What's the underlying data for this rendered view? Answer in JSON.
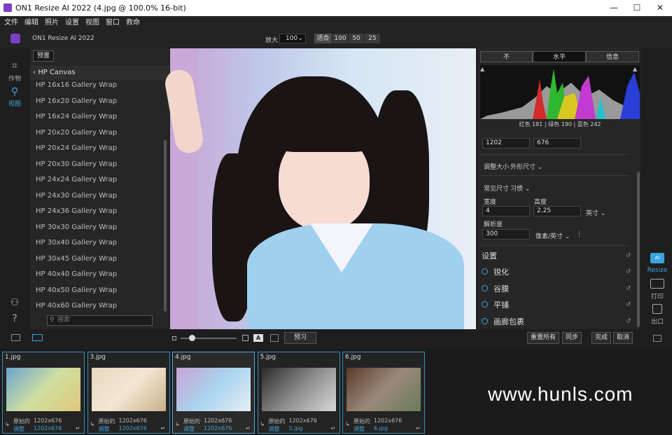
{
  "window": {
    "title": "ON1 Resize AI 2022 (4.jpg @ 100.0% 16-bit)",
    "min": "—",
    "max": "☐",
    "close": "✕"
  },
  "menu": [
    "文件",
    "编辑",
    "照片",
    "设置",
    "视图",
    "窗口",
    "救命"
  ],
  "toolbar": {
    "app_name": "ON1 Resize AI 2022",
    "zoom_label": "放大",
    "zoom_value": "100",
    "zoom_buttons": [
      "适合",
      "100",
      "50",
      "25"
    ]
  },
  "leftbar": {
    "crop_label": "作物",
    "view_label": "视图"
  },
  "browser": {
    "preset_btn": "预置",
    "folder": "HP Canvas",
    "items": [
      "HP 16x16 Gallery Wrap",
      "HP 16x20 Gallery Wrap",
      "HP 16x24 Gallery Wrap",
      "HP 20x20 Gallery Wrap",
      "HP 20x24 Gallery Wrap",
      "HP 20x30 Gallery Wrap",
      "HP 24x24 Gallery Wrap",
      "HP 24x30 Gallery Wrap",
      "HP 24x36 Gallery Wrap",
      "HP 30x30 Gallery Wrap",
      "HP 30x40 Gallery Wrap",
      "HP 30x45 Gallery Wrap",
      "HP 40x40 Gallery Wrap",
      "HP 40x50 Gallery Wrap",
      "HP 40x60 Gallery Wrap"
    ],
    "search_placeholder": "搜索"
  },
  "histogram": {
    "tabs": [
      "不",
      "水平",
      "信息"
    ],
    "readout": "红色 181 | 绿色 190 | 蓝色 242"
  },
  "resize": {
    "width_px": "1202",
    "height_px": "676",
    "mode_label": "调整大小",
    "mode_value": "外形尺寸",
    "common_label": "常见尺寸",
    "common_value": "习惯",
    "width_label": "宽度",
    "height_label": "高度",
    "width_val": "4",
    "height_val": "2.25",
    "unit": "英寸",
    "res_label": "解析度",
    "res_val": "300",
    "res_unit": "像素/英寸"
  },
  "settings": {
    "title": "设置",
    "items": [
      "锐化",
      "谷膜",
      "平铺",
      "画廊包裹"
    ]
  },
  "rtools": {
    "resize": "Resize",
    "print": "打印",
    "export": "出口"
  },
  "bottom": {
    "preview": "预习",
    "reset_all": "重置所有",
    "sync": "同步",
    "done": "完成",
    "cancel": "取消"
  },
  "filmstrip": [
    {
      "name": "1.jpg",
      "orig_label": "原始的",
      "orig": "1202x676",
      "adj_label": "调整",
      "adj": "1202x676"
    },
    {
      "name": "3.jpg",
      "orig_label": "原始的",
      "orig": "1202x676",
      "adj_label": "调整",
      "adj": "1202x676"
    },
    {
      "name": "4.jpg",
      "orig_label": "原始的",
      "orig": "1202x676",
      "adj_label": "调整",
      "adj": "1202x676"
    },
    {
      "name": "5.jpg",
      "orig_label": "原始的",
      "orig": "1202x676",
      "adj_label": "调整",
      "adj": "5.jpg"
    },
    {
      "name": "6.jpg",
      "orig_label": "原始的",
      "orig": "1202x676",
      "adj_label": "调整",
      "adj": "6.jpg"
    }
  ],
  "watermark": "www.hunls.com"
}
